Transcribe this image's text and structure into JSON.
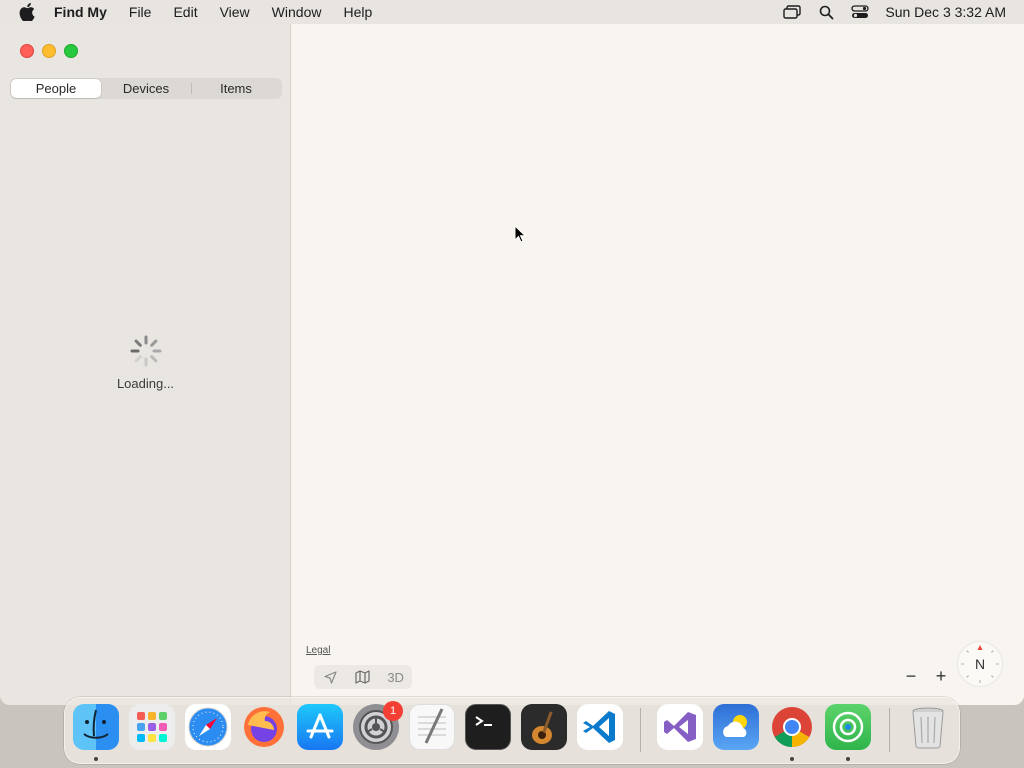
{
  "menubar": {
    "app_name": "Find My",
    "items": [
      "File",
      "Edit",
      "View",
      "Window",
      "Help"
    ],
    "clock": "Sun Dec 3  3:32 AM",
    "status_icons": [
      "screen-mirroring-icon",
      "spotlight-search-icon",
      "control-center-icon"
    ]
  },
  "sidebar": {
    "tabs": [
      {
        "label": "People",
        "active": true
      },
      {
        "label": "Devices",
        "active": false
      },
      {
        "label": "Items",
        "active": false
      }
    ],
    "loading_text": "Loading..."
  },
  "map": {
    "legal_label": "Legal",
    "view_3d_label": "3D",
    "zoom_out_label": "−",
    "zoom_in_label": "+",
    "compass_label": "N"
  },
  "dock": {
    "apps": [
      "Finder",
      "Launchpad",
      "Safari",
      "Firefox",
      "App Store",
      "System Settings",
      "TextEdit",
      "Terminal",
      "GarageBand",
      "Visual Studio Code",
      "Visual Studio",
      "Weather",
      "Google Chrome",
      "Find My",
      "Trash"
    ],
    "settings_badge": "1",
    "colors": {
      "accent": "#007aff",
      "close": "#fe5f57",
      "minimize": "#febc2e",
      "maximize": "#28c840"
    }
  }
}
